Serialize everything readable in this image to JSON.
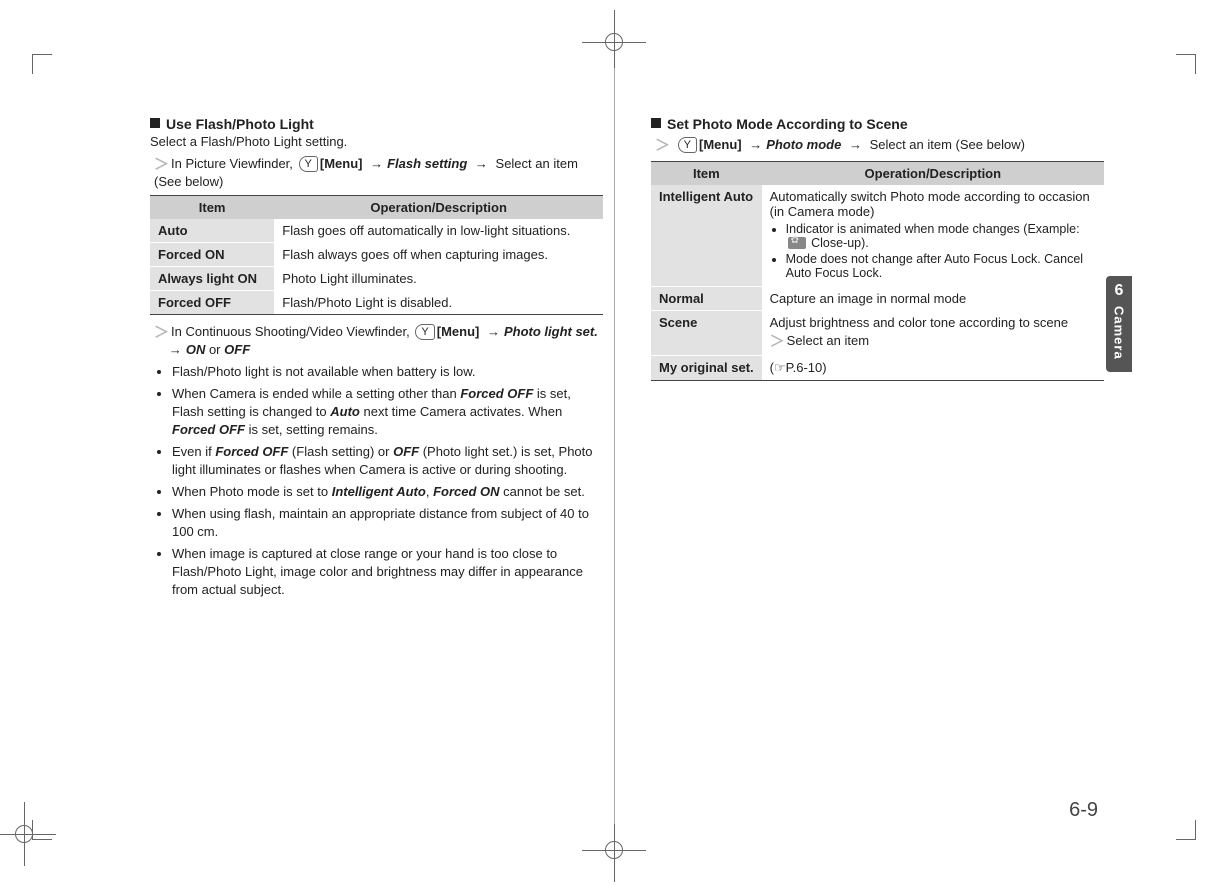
{
  "tab": {
    "num": "6",
    "label": "Camera"
  },
  "pageNumber": "6-9",
  "left": {
    "heading": "Use Flash/Photo Light",
    "subtitle": "Select a Flash/Photo Light setting.",
    "step1_prefix": "In Picture Viewfinder, ",
    "menuBtn": "[Menu]",
    "step1_setting": "Flash setting",
    "step1_suffix": " Select an item (See below)",
    "tableHead": {
      "item": "Item",
      "desc": "Operation/Description"
    },
    "rows": [
      {
        "item": "Auto",
        "desc": "Flash goes off automatically in low-light situations."
      },
      {
        "item": "Forced ON",
        "desc": "Flash always goes off when capturing images."
      },
      {
        "item": "Always light ON",
        "desc": "Photo Light illuminates."
      },
      {
        "item": "Forced OFF",
        "desc": "Flash/Photo Light is disabled."
      }
    ],
    "step2_prefix": "In Continuous Shooting/Video Viewfinder, ",
    "step2_setting": "Photo light set.",
    "step2_on": "ON",
    "step2_or": " or ",
    "step2_off": "OFF",
    "bullets": [
      {
        "text": "Flash/Photo light is not available when battery is low."
      },
      {
        "pre": "When Camera is ended while a setting other than ",
        "b1": "Forced OFF",
        "mid1": " is set, Flash setting is changed to ",
        "b2": "Auto",
        "mid2": " next time Camera activates. When ",
        "b3": "Forced OFF",
        "suf": " is set, setting remains."
      },
      {
        "pre": "Even if ",
        "b1": "Forced OFF",
        "mid1": " (Flash setting) or ",
        "b2": "OFF",
        "suf": " (Photo light set.) is set, Photo light illuminates or flashes when Camera is active or during shooting."
      },
      {
        "pre": "When Photo mode is set to ",
        "b1": "Intelligent Auto",
        "mid1": ", ",
        "b2": "Forced ON",
        "suf": " cannot be set."
      },
      {
        "text": "When using flash, maintain an appropriate distance from subject of 40 to 100 cm."
      },
      {
        "text": "When image is captured at close range or your hand is too close to Flash/Photo Light, image color and brightness may differ in appearance from actual subject."
      }
    ]
  },
  "right": {
    "heading": "Set Photo Mode According to Scene",
    "menuBtn": "[Menu]",
    "step_setting": "Photo mode",
    "step_suffix": " Select an item (See below)",
    "tableHead": {
      "item": "Item",
      "desc": "Operation/Description"
    },
    "rows": {
      "intel": {
        "item": "Intelligent Auto",
        "main": "Automatically switch Photo mode according to occasion (in Camera mode)",
        "b1_pre": "Indicator is animated when mode changes (Example: ",
        "b1_suf": " Close-up).",
        "b2": "Mode does not change after Auto Focus Lock. Cancel Auto Focus Lock."
      },
      "normal": {
        "item": "Normal",
        "desc": "Capture an image in normal mode"
      },
      "scene": {
        "item": "Scene",
        "desc": "Adjust brightness and color tone according to scene",
        "sub": "Select an item"
      },
      "myorig": {
        "item": "My original set.",
        "ref": "P.6-10"
      }
    }
  }
}
